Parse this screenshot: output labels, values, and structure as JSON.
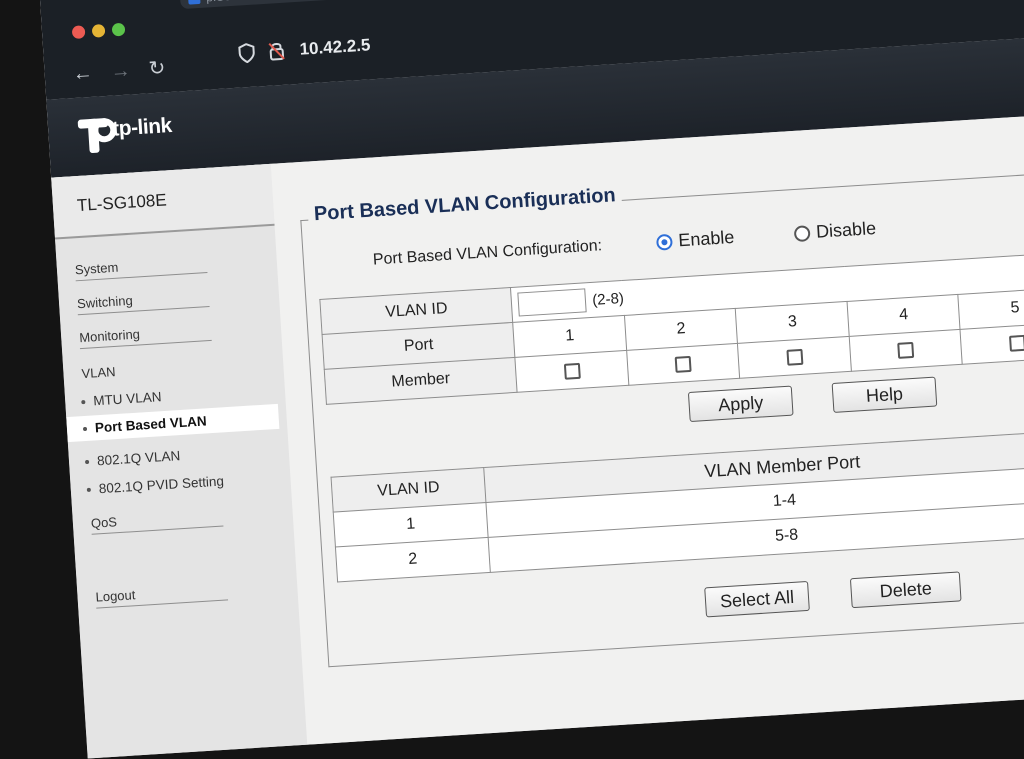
{
  "browser": {
    "tab_label": "pfSense",
    "url": "10.42.2.5",
    "icons": {
      "back": "back-arrow-icon",
      "forward": "forward-arrow-icon",
      "reload": "reload-icon",
      "shield": "shield-icon",
      "lock": "lock-icon"
    }
  },
  "brand": {
    "logo_text": "tp-link"
  },
  "sidebar": {
    "model": "TL-SG108E",
    "menu": [
      "System",
      "Switching",
      "Monitoring"
    ],
    "vlan_header": "VLAN",
    "vlan_items": [
      "MTU VLAN",
      "Port Based VLAN",
      "802.1Q VLAN",
      "802.1Q PVID Setting"
    ],
    "qos": "QoS",
    "logout": "Logout"
  },
  "main": {
    "title": "Port Based VLAN Configuration",
    "config_label": "Port Based VLAN Configuration:",
    "enable_label": "Enable",
    "disable_label": "Disable",
    "enabled": true,
    "config_table": {
      "vlan_id_label": "VLAN ID",
      "vlan_id_value": "",
      "range_text": "(2-8)",
      "port_label": "Port",
      "member_label": "Member",
      "ports": [
        "1",
        "2",
        "3",
        "4",
        "5"
      ],
      "members_checked": [
        false,
        false,
        false,
        false,
        false
      ]
    },
    "apply_label": "Apply",
    "help_label": "Help",
    "members_table": {
      "headers": [
        "VLAN ID",
        "VLAN Member Port"
      ],
      "rows": [
        {
          "vlan_id": "1",
          "ports": "1-4"
        },
        {
          "vlan_id": "2",
          "ports": "5-8"
        }
      ]
    },
    "select_all_label": "Select All",
    "delete_label": "Delete"
  },
  "colors": {
    "header": "#1d2229",
    "accent": "#2f6fd8",
    "title": "#1a2f57"
  }
}
